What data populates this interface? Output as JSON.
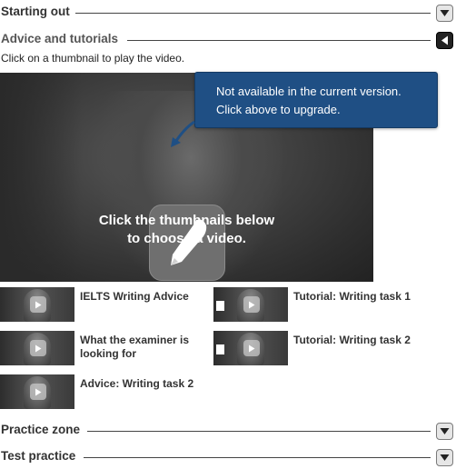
{
  "sections": {
    "starting_out": "Starting out",
    "advice": "Advice and tutorials",
    "practice_zone": "Practice zone",
    "test_practice": "Test practice"
  },
  "instruction": "Click on a thumbnail to play the video.",
  "video": {
    "caption_line1": "Click the thumbnails below",
    "caption_line2": "to choose a video."
  },
  "tooltip": {
    "line1": "Not available in the current version.",
    "line2": "Click above to upgrade."
  },
  "thumbnails": [
    {
      "line1": "IELTS Writing Advice",
      "line2": "",
      "has_doc_icon": false
    },
    {
      "line1": "Tutorial: Writing task 1",
      "line2": "",
      "has_doc_icon": true
    },
    {
      "line1": "What the examiner is",
      "line2": "looking for",
      "has_doc_icon": false
    },
    {
      "line1": "Tutorial: Writing task 2",
      "line2": "",
      "has_doc_icon": true
    },
    {
      "line1": "Advice: Writing task 2",
      "line2": "",
      "has_doc_icon": false
    }
  ],
  "icons": {
    "collapsed_toggle": "chevron-down-icon",
    "expanded_toggle": "triangle-left-icon",
    "video_placeholder": "pen-icon",
    "thumbnail_play": "play-icon"
  },
  "colors": {
    "tooltip_bg": "#1f4f84",
    "expanded_toggle_bg": "#222222",
    "collapsed_toggle_bg": "#e6e6e6"
  }
}
